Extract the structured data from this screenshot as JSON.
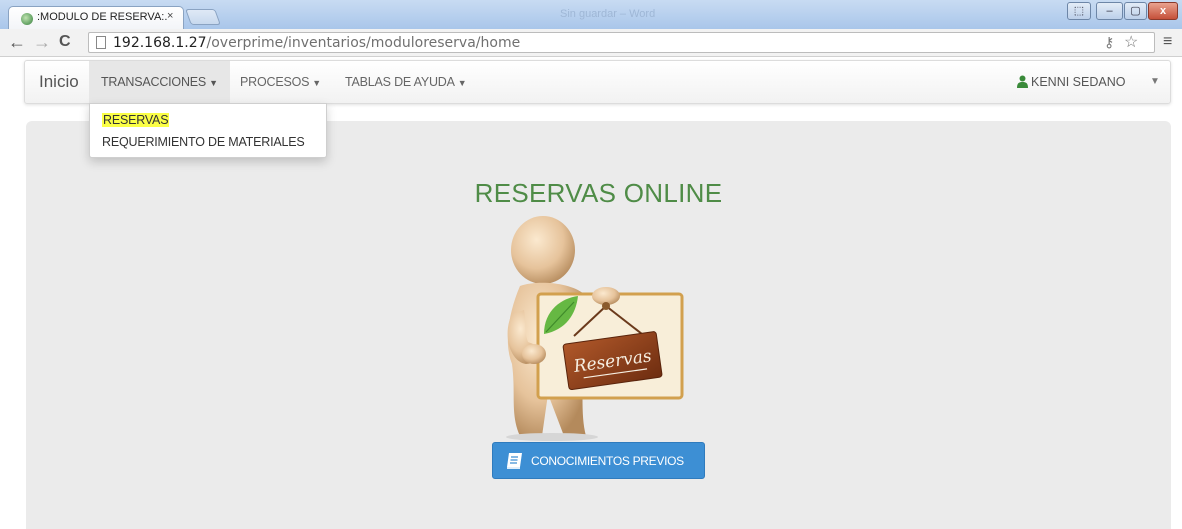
{
  "browser": {
    "window_title": "Sin guardar – Word",
    "tab": {
      "title": ":MODULO DE RESERVA:.",
      "close": "×"
    },
    "address": {
      "host": "192.168.1.27",
      "path": "/overprime/inventarios/moduloreserva/home"
    },
    "controls": {
      "minimize": "–",
      "maximize": "▢",
      "close": "x"
    }
  },
  "navbar": {
    "brand": "Inicio",
    "menus": [
      {
        "label": "TRANSACCIONES"
      },
      {
        "label": "PROCESOS"
      },
      {
        "label": "TABLAS DE AYUDA"
      }
    ],
    "user": {
      "name": "KENNI SEDANO"
    }
  },
  "dropdown": {
    "items": [
      {
        "label": "RESERVAS"
      },
      {
        "label": "REQUERIMIENTO DE MATERIALES"
      }
    ]
  },
  "main": {
    "heading": "RESERVAS ONLINE",
    "sign_text": "Reservas",
    "button_label": "CONOCIMIENTOS PREVIOS"
  },
  "colors": {
    "heading_green": "#4f8c47",
    "button_blue": "#3d8fd4",
    "highlight_yellow": "#fbff46",
    "user_icon_green": "#3a8a3a"
  },
  "icons": [
    "favicon-icon",
    "close-tab-icon",
    "back-icon",
    "forward-icon",
    "reload-icon",
    "page-icon",
    "key-icon",
    "star-icon",
    "menu-icon",
    "user-icon",
    "caret-down-icon",
    "book-icon"
  ]
}
